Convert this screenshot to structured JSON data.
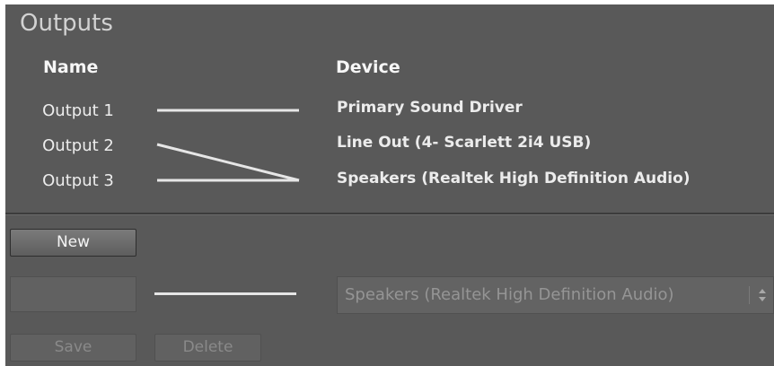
{
  "panel": {
    "title": "Outputs"
  },
  "columns": {
    "name_header": "Name",
    "device_header": "Device"
  },
  "outputs": [
    {
      "name": "Output 1",
      "device_index": 0
    },
    {
      "name": "Output 2",
      "device_index": 2
    },
    {
      "name": "Output 3",
      "device_index": 2
    }
  ],
  "devices": [
    "Primary Sound Driver",
    "Line Out (4- Scarlett 2i4 USB)",
    "Speakers (Realtek High Definition Audio)"
  ],
  "actions": {
    "new_label": "New",
    "save_label": "Save",
    "delete_label": "Delete"
  },
  "editor": {
    "name_value": "",
    "selected_device": "Speakers (Realtek High Definition Audio)"
  },
  "colors": {
    "panel_bg": "#595959",
    "text": "#ececec",
    "disabled_text": "#8a8a8a",
    "line": "#e6e6e6"
  }
}
